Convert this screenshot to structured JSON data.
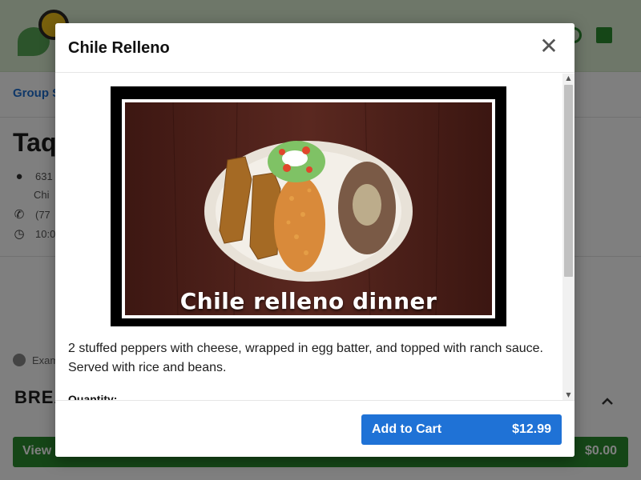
{
  "background": {
    "group_link": "Group S",
    "restaurant_title": "Taq",
    "address_line1": "631",
    "address_line2": "Chi",
    "phone": "(77",
    "hours": "10:0",
    "notice": "Exam",
    "section_title": "BREA",
    "cart_bar": {
      "label": "View",
      "total": "$0.00"
    }
  },
  "modal": {
    "title": "Chile Relleno",
    "close_symbol": "✕",
    "image_caption": "Chile relleno dinner",
    "description": "2 stuffed peppers with cheese, wrapped in egg batter, and topped with ranch sauce. Served with rice and beans.",
    "quantity_label": "Quantity:",
    "add_to_cart_label": "Add to Cart",
    "price": "$12.99"
  },
  "colors": {
    "primary_blue": "#1f72d6",
    "header_green": "#dcefd3",
    "cart_green": "#2b8c2f"
  },
  "icons": [
    "close-icon",
    "location-pin-icon",
    "phone-icon",
    "clock-icon",
    "chevron-up-icon",
    "user-icon",
    "cart-icon"
  ]
}
